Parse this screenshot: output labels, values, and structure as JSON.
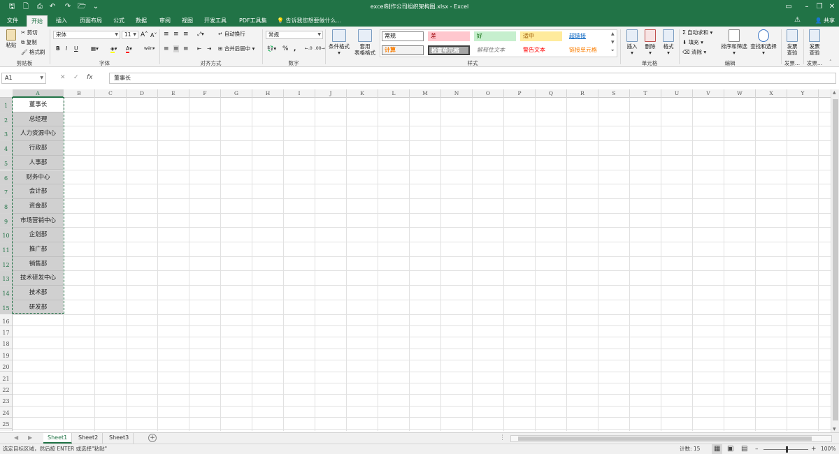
{
  "window": {
    "title": "excel制作公司组织架构图.xlsx - Excel"
  },
  "tabs": [
    "文件",
    "开始",
    "插入",
    "页面布局",
    "公式",
    "数据",
    "审阅",
    "视图",
    "开发工具",
    "PDF工具集"
  ],
  "active_tab": "开始",
  "tell_me": "告诉我您想要做什么...",
  "share_label": "共享",
  "ribbon": {
    "clipboard": {
      "paste": "粘贴",
      "cut": "剪切",
      "copy": "复制",
      "format_painter": "格式刷",
      "label": "剪贴板"
    },
    "font": {
      "name": "宋体",
      "size": "11",
      "label": "字体",
      "bold": "B",
      "italic": "I",
      "underline": "U",
      "grow": "A",
      "shrink": "A",
      "font_color": "A",
      "wen": "wén"
    },
    "alignment": {
      "wrap": "自动换行",
      "merge": "合并后居中",
      "label": "对齐方式"
    },
    "number": {
      "format": "常规",
      "label": "数字",
      "percent": "%",
      "comma": ","
    },
    "styles": {
      "conditional": "条件格式",
      "table": "套用\n表格格式",
      "label": "样式",
      "cells": [
        {
          "text": "常规",
          "bg": "#ffffff",
          "color": "#000000",
          "border": "#8a8a8a"
        },
        {
          "text": "差",
          "bg": "#ffc7ce",
          "color": "#9c0006",
          "border": "transparent"
        },
        {
          "text": "好",
          "bg": "#c6efce",
          "color": "#006100",
          "border": "transparent"
        },
        {
          "text": "适中",
          "bg": "#ffeb9c",
          "color": "#9c5700",
          "border": "transparent"
        },
        {
          "text": "超链接",
          "bg": "transparent",
          "color": "#0563c1",
          "border": "transparent"
        },
        {
          "text": "计算",
          "bg": "#f2f2f2",
          "color": "#fa7d00",
          "border": "#7f7f7f"
        },
        {
          "text": "检查单元格",
          "bg": "#a5a5a5",
          "color": "#ffffff",
          "border": "#3f3f3f"
        },
        {
          "text": "解释性文本",
          "bg": "transparent",
          "color": "#7f7f7f",
          "border": "transparent"
        },
        {
          "text": "警告文本",
          "bg": "transparent",
          "color": "#ff0000",
          "border": "transparent"
        },
        {
          "text": "链接单元格",
          "bg": "transparent",
          "color": "#fa7d00",
          "border": "transparent"
        }
      ]
    },
    "cells": {
      "insert": "插入",
      "delete": "删除",
      "format": "格式",
      "label": "单元格"
    },
    "editing": {
      "autosum": "自动求和",
      "fill": "填充",
      "clear": "清除",
      "sort": "排序和筛选",
      "find": "查找和选择",
      "label": "编辑"
    },
    "invoice1": {
      "text": "发票\n查验",
      "label": "发票..."
    },
    "invoice2": {
      "text": "发票\n查验",
      "label": "发票..."
    }
  },
  "formula_bar": {
    "name_box": "A1",
    "content": "董事长",
    "fx": "fx"
  },
  "columns": [
    "A",
    "B",
    "C",
    "D",
    "E",
    "F",
    "G",
    "H",
    "I",
    "J",
    "K",
    "L",
    "M",
    "N",
    "O",
    "P",
    "Q",
    "R",
    "S",
    "T",
    "U",
    "V",
    "W",
    "X",
    "Y"
  ],
  "rows": [
    "1",
    "2",
    "3",
    "4",
    "5",
    "6",
    "7",
    "8",
    "9",
    "10",
    "11",
    "12",
    "13",
    "14",
    "15",
    "16",
    "17",
    "18",
    "19",
    "20",
    "21",
    "22",
    "23",
    "24",
    "25"
  ],
  "column_a": [
    "董事长",
    "总经理",
    "人力资源中心",
    "行政部",
    "人事部",
    "财务中心",
    "会计部",
    "资金部",
    "市场营销中心",
    "企划部",
    "推广部",
    "销售部",
    "技术研发中心",
    "技术部",
    "研发部"
  ],
  "sheets": [
    "Sheet1",
    "Sheet2",
    "Sheet3"
  ],
  "active_sheet": "Sheet1",
  "status": {
    "message": "选定目标区域，然后按 ENTER 或选择\"粘贴\"",
    "count": "计数: 15",
    "zoom": "100%"
  },
  "colors": {
    "accent": "#217346",
    "selection_fill": "#d0d0d0"
  }
}
